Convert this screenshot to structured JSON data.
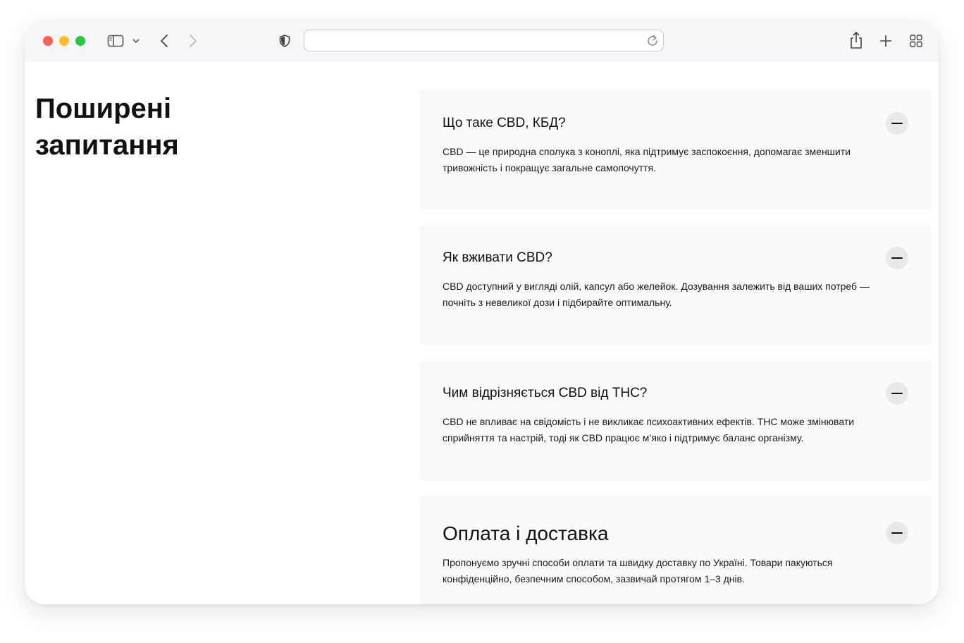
{
  "browser": {
    "address": ""
  },
  "faq": {
    "heading": "Поширені запитання",
    "items": [
      {
        "question": "Що таке CBD, КБД?",
        "answer": "CBD — це природна сполука з коноплі, яка підтримує заспокоєння, допомагає зменшити тривожність і покращує загальне самопочуття."
      },
      {
        "question": "Як вживати CBD?",
        "answer": "CBD доступний у вигляді олій, капсул або желейок. Дозування залежить від ваших потреб — почніть з невеликої дози і підбирайте оптимальну."
      },
      {
        "question": "Чим відрізняється CBD від THC?",
        "answer": "CBD не впливає на свідомість і не викликає психоактивних ефектів. THC може змінювати сприйняття та настрій, тоді як CBD працює м’яко і підтримує баланс організму."
      },
      {
        "question": "Оплата і доставка",
        "answer": "Пропонуємо зручні способи оплати та швидку доставку по Україні. Товари пакуються конфіденційно, безпечним способом, зазвичай протягом 1–3 днів."
      }
    ]
  },
  "icons": {
    "sidebar": "sidebar-icon",
    "chevron_down": "chevron-down-icon",
    "back": "back-arrow-icon",
    "forward": "forward-arrow-icon",
    "privacy": "shield-icon",
    "reload": "reload-icon",
    "share": "share-icon",
    "new_tab": "plus-icon",
    "tab_overview": "grid-icon",
    "collapse": "minus-icon"
  },
  "colors": {
    "window_bg": "#ffffff",
    "toolbar_bg": "#f6f6f8",
    "card_bg": "#faf9fb",
    "toggle_bg": "#e9e8eb",
    "text": "#111111"
  }
}
